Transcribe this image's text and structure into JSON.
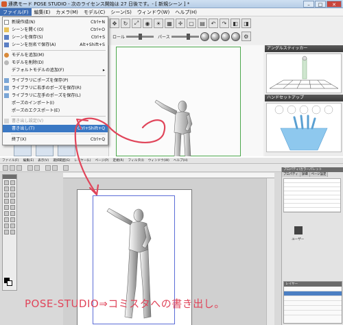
{
  "colors": {
    "accent": "#3a78c4",
    "annotation": "#e0455a",
    "frame_green": "#4aa64a",
    "frame_blue": "#5a6bd6"
  },
  "pose_studio": {
    "title": "連携モード POSE STUDIO - 次のライセンス開始は 27 日後です。- [ 新規シーン ] *",
    "menu": [
      {
        "label": "ファイル(F)"
      },
      {
        "label": "編集(E)"
      },
      {
        "label": "カメラ(M)"
      },
      {
        "label": "モデル(C)"
      },
      {
        "label": "シーン(S)"
      },
      {
        "label": "ウィンドウ(W)"
      },
      {
        "label": "ヘルプ(H)"
      }
    ],
    "toolbar": {
      "roll_label": "ロール",
      "perspective_label": "パース"
    },
    "panels": {
      "angle": "アングルスティッカー",
      "hand": "ハンドセットアップ"
    },
    "file_menu": [
      {
        "label": "新規作成(N)",
        "shortcut": "Ctrl+N"
      },
      {
        "label": "シーンを開く(O)",
        "shortcut": "Ctrl+O"
      },
      {
        "label": "シーンを保存(S)",
        "shortcut": "Ctrl+S"
      },
      {
        "label": "シーンを別名で保存(A)",
        "shortcut": "Alt+Shift+S"
      },
      {
        "label": "モデルを追加(M)",
        "shortcut": ""
      },
      {
        "label": "モデルを削除(D)",
        "shortcut": ""
      },
      {
        "label": "デフォルトモデルの追加(F)",
        "shortcut": "▸"
      },
      {
        "label": "ライブラリにポーズを保存(P)",
        "shortcut": ""
      },
      {
        "label": "ライブラリに右手のポーズを保存(R)",
        "shortcut": ""
      },
      {
        "label": "ライブラリに左手のポーズを保存(L)",
        "shortcut": ""
      },
      {
        "label": "ポーズのインポート(I)",
        "shortcut": ""
      },
      {
        "label": "ポーズのエクスポート(E)",
        "shortcut": ""
      },
      {
        "label": "書き出し設定(V)",
        "shortcut": ""
      },
      {
        "label": "書き出し(T)",
        "shortcut": "Ctrl+Shift+Q"
      },
      {
        "label": "終了(X)",
        "shortcut": "Ctrl+Q"
      }
    ]
  },
  "comic_studio": {
    "menu": [
      "ファイル(F)",
      "編集(E)",
      "表示(V)",
      "選択範囲(S)",
      "レイヤー(L)",
      "ページ(P)",
      "定規(R)",
      "フィルタ(I)",
      "ウィンドウ(W)",
      "ヘルプ(H)"
    ],
    "right_title": "プロパティ/カラーパレット",
    "tabs": [
      "プロパティ",
      "詳細",
      "ページ設定"
    ],
    "layer_title": "レイヤー",
    "user_label": "ユーザー"
  },
  "caption": "POSE-STUDIO⇒コミスタへの書き出し。"
}
